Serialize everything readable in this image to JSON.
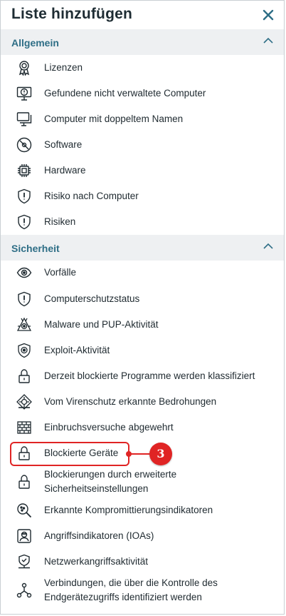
{
  "header": {
    "title": "Liste hinzufügen",
    "close_icon": "close-icon"
  },
  "accent_color": "#2e6e86",
  "sections": [
    {
      "title": "Allgemein",
      "items": [
        {
          "label": "Lizenzen",
          "icon": "license-icon"
        },
        {
          "label": "Gefundene nicht verwaltete Computer",
          "icon": "monitor-alert-icon"
        },
        {
          "label": "Computer mit doppeltem Namen",
          "icon": "duplicate-monitor-icon"
        },
        {
          "label": "Software",
          "icon": "disc-icon"
        },
        {
          "label": "Hardware",
          "icon": "chip-icon"
        },
        {
          "label": "Risiko nach Computer",
          "icon": "shield-alert-icon"
        },
        {
          "label": "Risiken",
          "icon": "shield-alert-icon"
        }
      ]
    },
    {
      "title": "Sicherheit",
      "items": [
        {
          "label": "Vorfälle",
          "icon": "eye-icon"
        },
        {
          "label": "Computerschutzstatus",
          "icon": "shield-alert-icon"
        },
        {
          "label": "Malware und PUP-Aktivität",
          "icon": "malware-icon"
        },
        {
          "label": "Exploit-Aktivität",
          "icon": "exploit-icon"
        },
        {
          "label": "Derzeit blockierte Programme werden klassifiziert",
          "icon": "lock-icon"
        },
        {
          "label": "Vom Virenschutz erkannte Bedrohungen",
          "icon": "virus-icon"
        },
        {
          "label": "Einbruchsversuche abgewehrt",
          "icon": "firewall-icon"
        },
        {
          "label": "Blockierte Geräte",
          "icon": "lock-icon"
        },
        {
          "label": "Blockierungen durch erweiterte Sicherheitseinstellungen",
          "line1": "Blockierungen durch erweiterte",
          "line2": "Sicherheitseinstellungen",
          "icon": "lock-icon"
        },
        {
          "label": "Erkannte Kompromittierungsindikatoren",
          "icon": "search-ioc-icon"
        },
        {
          "label": "Angriffsindikatoren (IOAs)",
          "icon": "attacker-icon"
        },
        {
          "label": "Netzwerkangriffsaktivität",
          "icon": "network-shield-icon"
        },
        {
          "label": "Verbindungen, die über die Kontrolle des Endgerätezugriffs identifiziert werden",
          "line1": "Verbindungen, die über die Kontrolle des",
          "line2": "Endgerätezugriffs identifiziert werden",
          "icon": "network-nodes-icon"
        }
      ]
    }
  ],
  "callout": {
    "number": "3",
    "color": "#e02424"
  }
}
